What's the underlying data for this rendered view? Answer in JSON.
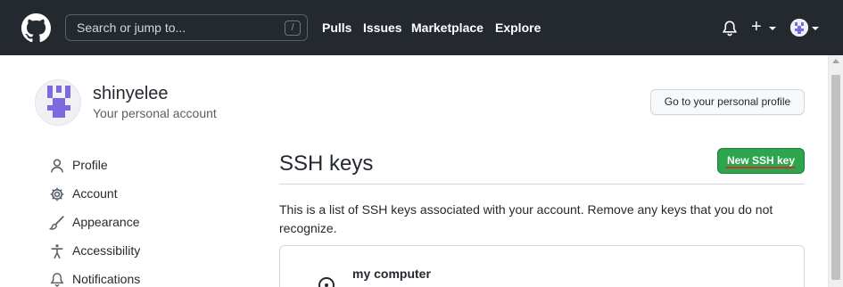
{
  "header": {
    "search_placeholder": "Search or jump to...",
    "search_shortcut": "/",
    "nav": [
      "Pulls",
      "Issues",
      "Marketplace",
      "Explore"
    ],
    "plus_symbol": "+",
    "icons": [
      "github-logo-icon",
      "bell-icon",
      "plus-icon",
      "avatar"
    ]
  },
  "account": {
    "username": "shinyelee",
    "subtitle": "Your personal account",
    "profile_button": "Go to your personal profile"
  },
  "sidebar": {
    "items": [
      {
        "label": "Profile",
        "icon": "person-icon"
      },
      {
        "label": "Account",
        "icon": "gear-icon"
      },
      {
        "label": "Appearance",
        "icon": "paintbrush-icon"
      },
      {
        "label": "Accessibility",
        "icon": "accessibility-icon"
      },
      {
        "label": "Notifications",
        "icon": "bell-icon"
      }
    ]
  },
  "main": {
    "title": "SSH keys",
    "new_button": "New SSH key",
    "description": "This is a list of SSH keys associated with your account. Remove any keys that you do not recognize.",
    "keys": [
      {
        "name": "my computer",
        "icon": "key-icon"
      }
    ]
  },
  "colors": {
    "header_bg": "#24292f",
    "primary_green": "#2da44e",
    "annotation_red": "#c0392b",
    "identicon": "#7b6ae0"
  }
}
